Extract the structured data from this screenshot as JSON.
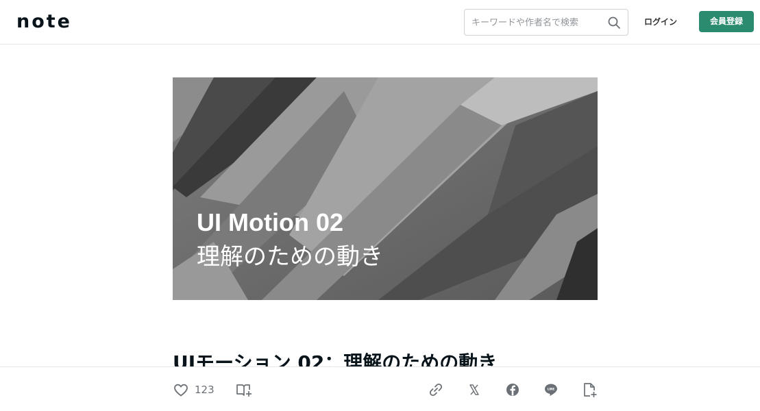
{
  "header": {
    "logo_text": "note",
    "search_placeholder": "キーワードや作者名で検索",
    "login_label": "ログイン",
    "signup_label": "会員登録"
  },
  "hero": {
    "title": "UI Motion 02",
    "subtitle": "理解のための動き"
  },
  "article": {
    "title": "UIモーション 02：理解のための動き"
  },
  "action_bar": {
    "like_count": "123",
    "icons": [
      "heart-icon",
      "magazine-add-icon",
      "link-icon",
      "x-icon",
      "facebook-icon",
      "line-icon",
      "embed-icon"
    ]
  },
  "colors": {
    "brand_green": "#2b8b6f",
    "text_dark": "#08131a",
    "muted_gray": "#6b7076"
  }
}
